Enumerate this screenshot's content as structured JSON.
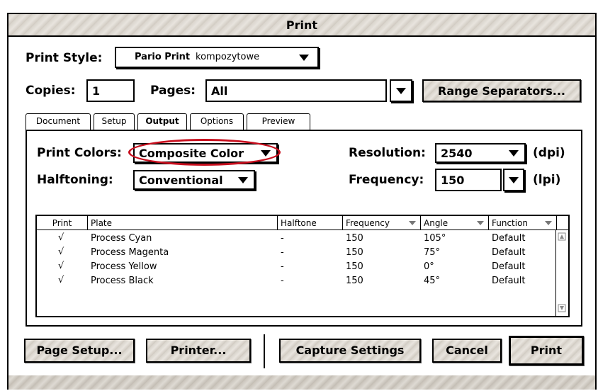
{
  "window": {
    "title": "Print"
  },
  "print_style": {
    "label": "Print Style:",
    "value_bold": "Pario Print",
    "value_rest": "kompozytowe"
  },
  "copies": {
    "label": "Copies:",
    "value": "1"
  },
  "pages": {
    "label": "Pages:",
    "value": "All"
  },
  "range_button": "Range Separators...",
  "tabs": [
    "Document",
    "Setup",
    "Output",
    "Options",
    "Preview"
  ],
  "active_tab": "Output",
  "print_colors": {
    "label": "Print Colors:",
    "value": "Composite Color"
  },
  "halftoning": {
    "label": "Halftoning:",
    "value": "Conventional"
  },
  "resolution": {
    "label": "Resolution:",
    "value": "2540",
    "unit": "(dpi)"
  },
  "frequency": {
    "label": "Frequency:",
    "value": "150",
    "unit": "(lpi)"
  },
  "table": {
    "headers": [
      "Print",
      "Plate",
      "Halftone",
      "Frequency",
      "Angle",
      "Function"
    ],
    "rows": [
      {
        "print": "√",
        "plate": "Process Cyan",
        "halftone": "-",
        "frequency": "150",
        "angle": "105°",
        "function": "Default"
      },
      {
        "print": "√",
        "plate": "Process Magenta",
        "halftone": "-",
        "frequency": "150",
        "angle": "75°",
        "function": "Default"
      },
      {
        "print": "√",
        "plate": "Process Yellow",
        "halftone": "-",
        "frequency": "150",
        "angle": "0°",
        "function": "Default"
      },
      {
        "print": "√",
        "plate": "Process Black",
        "halftone": "-",
        "frequency": "150",
        "angle": "45°",
        "function": "Default"
      }
    ]
  },
  "buttons": {
    "page_setup": "Page Setup...",
    "printer": "Printer...",
    "capture": "Capture Settings",
    "cancel": "Cancel",
    "print": "Print"
  },
  "colors": {
    "highlight_oval": "#c80f1e"
  }
}
